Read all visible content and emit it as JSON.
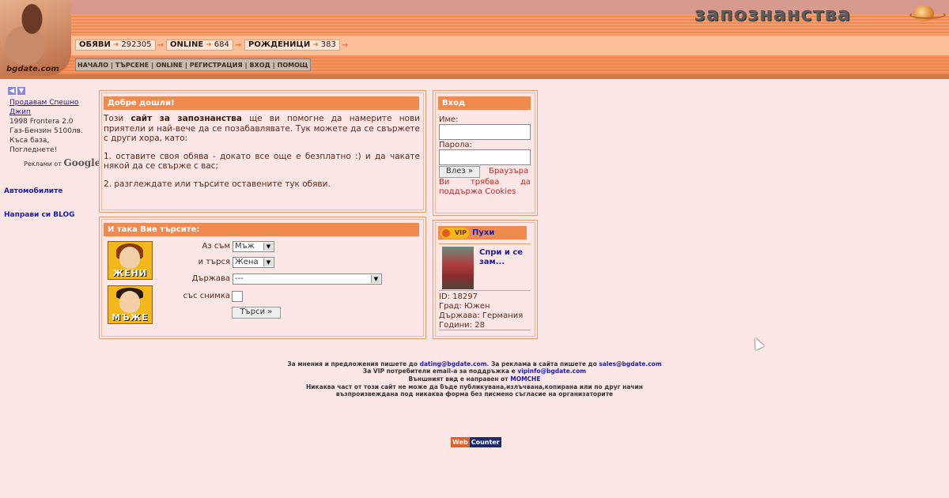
{
  "header": {
    "brand": "запознанства",
    "logo_text": "bgdate.com",
    "stats": [
      {
        "label": "ОБЯВИ",
        "value": "292305"
      },
      {
        "label": "ONLINE",
        "value": "684"
      },
      {
        "label": "РОЖДЕНИЦИ",
        "value": "383"
      }
    ],
    "nav": [
      "НАЧАЛО",
      "ТЪРСЕНЕ",
      "ONLINE",
      "РЕГИСТРАЦИЯ",
      "ВХОД",
      "ПОМОЩ"
    ]
  },
  "sidebar": {
    "ad_title": "Продавам Спешно Джип",
    "ad_lines": [
      "1998 Frontera 2.0",
      "Газ-Бензин 5100лв.",
      "Къса база,",
      "Погледнете!"
    ],
    "ads_by": "Реклами от",
    "google": "Google",
    "links": [
      "Автомобилите",
      "Направи си BLOG"
    ]
  },
  "welcome": {
    "title": "Добре дошли!",
    "intro_pre": "Този",
    "intro_bold": "сайт за запознанства",
    "intro_post": "ще ви помогне да намерите нови приятели и най-вече да се позабавлявате. Тук можете да се свържете с други хора, като:",
    "point1": "1. оставите своя обява - докато все още е безплатно :) и да чакате някой да се свърже с вас;",
    "point2": "2. разглеждате или търсите оставените тук обяви."
  },
  "login": {
    "title": "Вход",
    "name_label": "Име:",
    "password_label": "Парола:",
    "submit": "Влез »",
    "browser_note_1": "Браузъра",
    "browser_note_2": "Ви трябва да",
    "browser_note_3": "поддържа Cookies"
  },
  "search": {
    "title": "И така Вие търсите:",
    "i_am_label": "Аз съм",
    "i_am_value": "Мъж",
    "seeking_label": "и търся",
    "seeking_value": "Жена",
    "country_label": "Държава",
    "country_value": "---",
    "photo_label": "със снимка",
    "submit": "Търси »",
    "avatar_women": "ЖЕНИ",
    "avatar_men": "МЪЖЕ"
  },
  "vip": {
    "badge": "VIP",
    "name": "Пухи",
    "link": "Спри и се зам...",
    "id": "ID: 18297",
    "city": "Град: Южен",
    "country": "Държава: Германия",
    "age": "Години: 28"
  },
  "footer": {
    "line1_pre": "За мнения и предложения пишете до",
    "email1": "dating@bgdate.com",
    "line1_mid": ". За реклама в сайта пишете до",
    "email2": "sales@bgdate.com",
    "line2_pre": "За VIP потребители email-a за поддръжка е",
    "email3": "vipinfo@bgdate.com",
    "line3_pre": "Външният вид е направен от",
    "author": "MOMCHE",
    "line4": "Никаква част от този сайт не може да бъде публикувана,излъчвана,копирана или по друг начин",
    "line5": "възпроизвеждана под никаква форма без писмено съгласие на организаторите"
  },
  "webcounter": {
    "a": "Web",
    "b": "Counter"
  }
}
